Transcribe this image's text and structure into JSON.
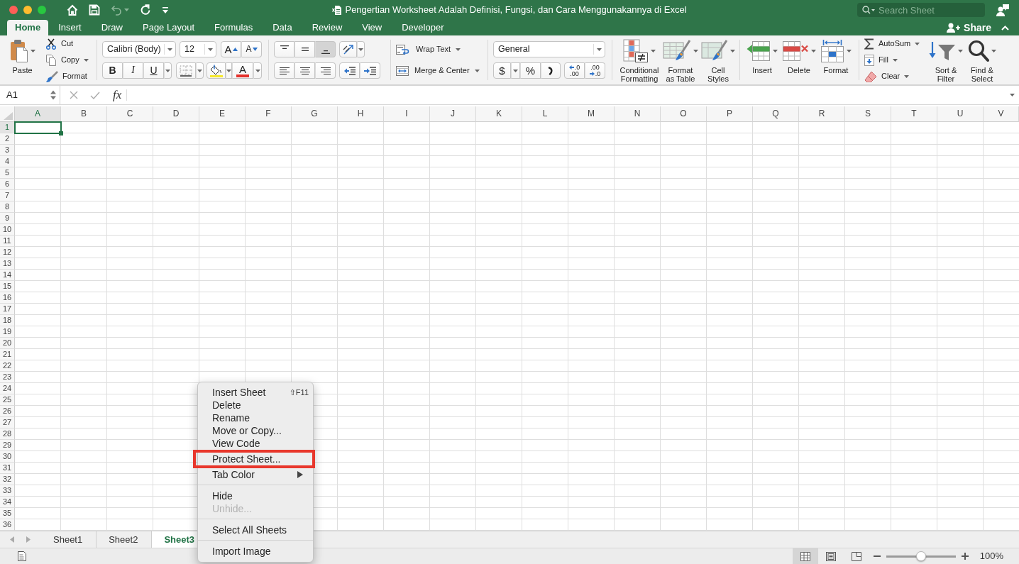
{
  "window": {
    "title": "Pengertian Worksheet Adalah Definisi, Fungsi, dan Cara Menggunakannya di Excel",
    "search": {
      "placeholder": "Search Sheet"
    }
  },
  "quick_access": [
    {
      "kind": "home",
      "disabled": false
    },
    {
      "kind": "save",
      "disabled": false
    },
    {
      "kind": "undo",
      "disabled": true
    },
    {
      "kind": "redo",
      "disabled": false
    },
    {
      "kind": "customize",
      "disabled": false
    }
  ],
  "ribbon_tabs": [
    {
      "label": "Home",
      "selected": true
    },
    {
      "label": "Insert",
      "selected": false
    },
    {
      "label": "Draw",
      "selected": false
    },
    {
      "label": "Page Layout",
      "selected": false
    },
    {
      "label": "Formulas",
      "selected": false
    },
    {
      "label": "Data",
      "selected": false
    },
    {
      "label": "Review",
      "selected": false
    },
    {
      "label": "View",
      "selected": false
    },
    {
      "label": "Developer",
      "selected": false
    }
  ],
  "share_button": {
    "label": "Share"
  },
  "ribbon": {
    "clipboard": {
      "paste": "Paste",
      "small": [
        {
          "kind": "cut",
          "label": "Cut",
          "dropdown": false
        },
        {
          "kind": "copy",
          "label": "Copy",
          "dropdown": true
        },
        {
          "kind": "format_painter",
          "label": "Format",
          "dropdown": false
        }
      ]
    },
    "font": {
      "name": "Calibri (Body)",
      "size": "12",
      "size_buttons": [
        {
          "kind": "grow",
          "label": "A"
        },
        {
          "kind": "shrink",
          "label": "A"
        }
      ],
      "styles": [
        {
          "kind": "bold",
          "label": "B"
        },
        {
          "kind": "italic",
          "label": "I"
        },
        {
          "kind": "underline",
          "label": "U"
        }
      ],
      "font_color": "A"
    },
    "alignment": {
      "vertical": [
        {
          "kind": "top",
          "selected": false
        },
        {
          "kind": "middle",
          "selected": false
        },
        {
          "kind": "bottom",
          "selected": true
        }
      ],
      "horizontal": [
        {
          "kind": "left",
          "selected": false
        },
        {
          "kind": "center",
          "selected": false
        },
        {
          "kind": "right",
          "selected": false
        }
      ],
      "wrap_text": "Wrap Text",
      "merge": "Merge & Center"
    },
    "number": {
      "format": "General",
      "currency": "$",
      "percent": "%",
      "decimals": [
        {
          "kind": "increase",
          "top": ".0",
          "bottom": ".00"
        },
        {
          "kind": "decrease",
          "top": ".00",
          "bottom": ".0"
        }
      ]
    },
    "styles": [
      {
        "kind": "conditional",
        "label": "Conditional\nFormatting"
      },
      {
        "kind": "table",
        "label": "Format\nas Table"
      },
      {
        "kind": "cell_styles",
        "label": "Cell\nStyles"
      }
    ],
    "cells": [
      {
        "kind": "insert",
        "label": "Insert"
      },
      {
        "kind": "delete",
        "label": "Delete"
      },
      {
        "kind": "format",
        "label": "Format"
      }
    ],
    "editing": {
      "small": [
        {
          "kind": "autosum",
          "label": "AutoSum"
        },
        {
          "kind": "fill",
          "label": "Fill"
        },
        {
          "kind": "clear",
          "label": "Clear"
        }
      ],
      "large": [
        {
          "kind": "sort_filter",
          "label": "Sort &\nFilter"
        },
        {
          "kind": "find_select",
          "label": "Find &\nSelect"
        }
      ]
    }
  },
  "formula_bar": {
    "name_box": "A1",
    "function_label": "fx"
  },
  "sheet": {
    "columns": [
      {
        "label": "A",
        "selected": true
      },
      {
        "label": "B",
        "selected": false
      },
      {
        "label": "C",
        "selected": false
      },
      {
        "label": "D",
        "selected": false
      },
      {
        "label": "E",
        "selected": false
      },
      {
        "label": "F",
        "selected": false
      },
      {
        "label": "G",
        "selected": false
      },
      {
        "label": "H",
        "selected": false
      },
      {
        "label": "I",
        "selected": false
      },
      {
        "label": "J",
        "selected": false
      },
      {
        "label": "K",
        "selected": false
      },
      {
        "label": "L",
        "selected": false
      },
      {
        "label": "M",
        "selected": false
      },
      {
        "label": "N",
        "selected": false
      },
      {
        "label": "O",
        "selected": false
      },
      {
        "label": "P",
        "selected": false
      },
      {
        "label": "Q",
        "selected": false
      },
      {
        "label": "R",
        "selected": false
      },
      {
        "label": "S",
        "selected": false
      },
      {
        "label": "T",
        "selected": false
      },
      {
        "label": "U",
        "selected": false
      },
      {
        "label": "V",
        "selected": false
      }
    ],
    "rows": [
      {
        "label": "1",
        "selected": true
      },
      {
        "label": "2",
        "selected": false
      },
      {
        "label": "3",
        "selected": false
      },
      {
        "label": "4",
        "selected": false
      },
      {
        "label": "5",
        "selected": false
      },
      {
        "label": "6",
        "selected": false
      },
      {
        "label": "7",
        "selected": false
      },
      {
        "label": "8",
        "selected": false
      },
      {
        "label": "9",
        "selected": false
      },
      {
        "label": "10",
        "selected": false
      },
      {
        "label": "11",
        "selected": false
      },
      {
        "label": "12",
        "selected": false
      },
      {
        "label": "13",
        "selected": false
      },
      {
        "label": "14",
        "selected": false
      },
      {
        "label": "15",
        "selected": false
      },
      {
        "label": "16",
        "selected": false
      },
      {
        "label": "17",
        "selected": false
      },
      {
        "label": "18",
        "selected": false
      },
      {
        "label": "19",
        "selected": false
      },
      {
        "label": "20",
        "selected": false
      },
      {
        "label": "21",
        "selected": false
      },
      {
        "label": "22",
        "selected": false
      },
      {
        "label": "23",
        "selected": false
      },
      {
        "label": "24",
        "selected": false
      },
      {
        "label": "25",
        "selected": false
      },
      {
        "label": "26",
        "selected": false
      },
      {
        "label": "27",
        "selected": false
      },
      {
        "label": "28",
        "selected": false
      },
      {
        "label": "29",
        "selected": false
      },
      {
        "label": "30",
        "selected": false
      },
      {
        "label": "31",
        "selected": false
      },
      {
        "label": "32",
        "selected": false
      },
      {
        "label": "33",
        "selected": false
      },
      {
        "label": "34",
        "selected": false
      },
      {
        "label": "35",
        "selected": false
      },
      {
        "label": "36",
        "selected": false
      }
    ]
  },
  "sheet_tabs": [
    {
      "label": "Sheet1",
      "selected": false
    },
    {
      "label": "Sheet2",
      "selected": false
    },
    {
      "label": "Sheet3",
      "selected": true
    }
  ],
  "context_menu": {
    "items": [
      {
        "kind": "item",
        "label": "Insert Sheet",
        "shortcut": "⇧F11",
        "disabled": false,
        "highlighted": false,
        "submenu": false
      },
      {
        "kind": "item",
        "label": "Delete",
        "disabled": false,
        "highlighted": false,
        "submenu": false
      },
      {
        "kind": "item",
        "label": "Rename",
        "disabled": false,
        "highlighted": false,
        "submenu": false
      },
      {
        "kind": "item",
        "label": "Move or Copy...",
        "disabled": false,
        "highlighted": false,
        "submenu": false
      },
      {
        "kind": "item",
        "label": "View Code",
        "disabled": false,
        "highlighted": false,
        "submenu": false
      },
      {
        "kind": "item",
        "label": "Protect Sheet...",
        "disabled": false,
        "highlighted": true,
        "submenu": false
      },
      {
        "kind": "item",
        "label": "Tab Color",
        "disabled": false,
        "highlighted": false,
        "submenu": true
      },
      {
        "kind": "separator"
      },
      {
        "kind": "item",
        "label": "Hide",
        "disabled": false,
        "highlighted": false,
        "submenu": false
      },
      {
        "kind": "item",
        "label": "Unhide...",
        "disabled": true,
        "highlighted": false,
        "submenu": false
      },
      {
        "kind": "separator"
      },
      {
        "kind": "item",
        "label": "Select All Sheets",
        "disabled": false,
        "highlighted": false,
        "submenu": false
      },
      {
        "kind": "separator"
      },
      {
        "kind": "item",
        "label": "Import Image",
        "disabled": false,
        "highlighted": false,
        "submenu": false
      }
    ]
  },
  "status_bar": {
    "views": [
      {
        "kind": "normal",
        "selected": true
      },
      {
        "kind": "page_layout",
        "selected": false
      },
      {
        "kind": "page_break",
        "selected": false
      }
    ],
    "zoom": {
      "level": 0.5,
      "reading": "100%"
    }
  }
}
